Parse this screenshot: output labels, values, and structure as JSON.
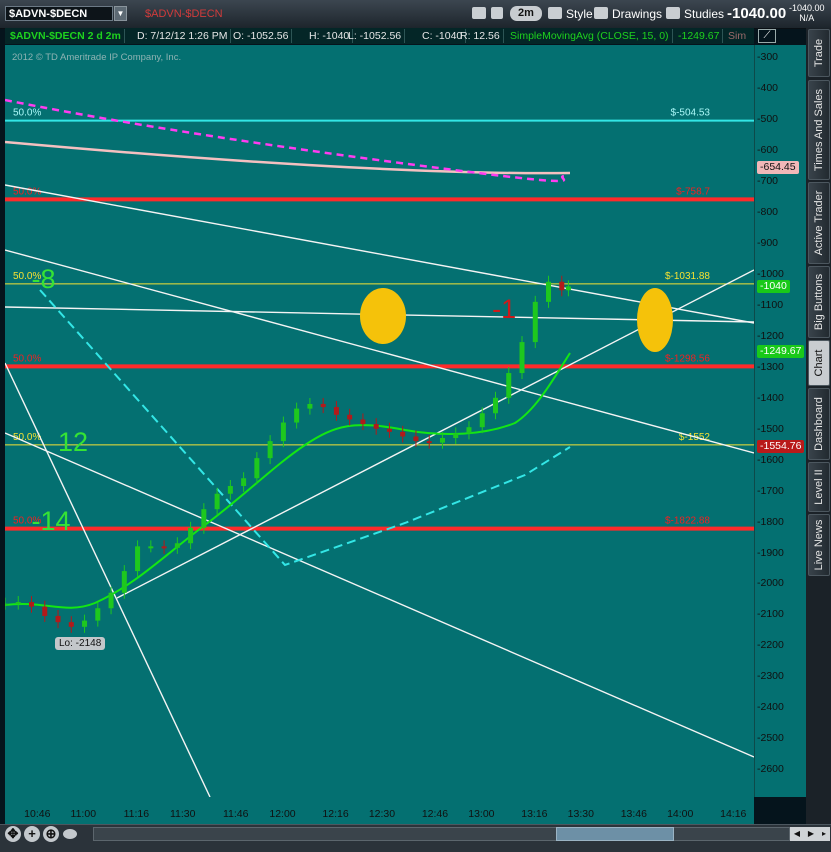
{
  "symbol_box": "$ADVN-$DECN",
  "symbol_desc": "$ADVN-$DECN",
  "toolbar": {
    "aggregation": "2m",
    "style": "Style",
    "drawings": "Drawings",
    "studies": "Studies",
    "last_price": "-1040.00",
    "net_change": "-1040.00",
    "net_change_pct": "N/A"
  },
  "info": {
    "title": "$ADVN-$DECN 2 d 2m",
    "date": "D: 7/12/12 1:26 PM",
    "open": "O: -1052.56",
    "high": "H: -1040",
    "low": "L: -1052.56",
    "close": "C: -1040",
    "range": "R: 12.56",
    "study": "SimpleMovingAvg (CLOSE, 15, 0)",
    "study_value": "-1249.67",
    "truncated": "Sim"
  },
  "copyright": "2012 © TD Ameritrade IP Company, Inc.",
  "y_ticks": [
    "-300",
    "-400",
    "-500",
    "-600",
    "-700",
    "-800",
    "-900",
    "-1000",
    "-1100",
    "-1200",
    "-1300",
    "-1400",
    "-1500",
    "-1600",
    "-1700",
    "-1800",
    "-1900",
    "-2000",
    "-2100",
    "-2200",
    "-2300",
    "-2400",
    "-2500",
    "-2600"
  ],
  "x_ticks": [
    "10:46",
    "11:00",
    "11:16",
    "11:30",
    "11:46",
    "12:00",
    "12:16",
    "12:30",
    "12:46",
    "13:00",
    "13:16",
    "13:30",
    "13:46",
    "14:00",
    "14:16"
  ],
  "y_tags": [
    {
      "text": "-654.45",
      "bg": "#f2b8b8",
      "fg": "#111111",
      "value": -654.45
    },
    {
      "text": "-1040",
      "bg": "#19c919",
      "fg": "#ffffff",
      "value": -1040
    },
    {
      "text": "-1249.67",
      "bg": "#19c919",
      "fg": "#ffffff",
      "value": -1249.67
    },
    {
      "text": "-1554.76",
      "bg": "#b91a1a",
      "fg": "#ffffff",
      "value": -1554.76
    }
  ],
  "levels": [
    {
      "price": -504.53,
      "color": "#33e6e6",
      "left_label": "50.0%",
      "right_label": "$-504.53",
      "label_color": "#a9f7f7",
      "width": 2
    },
    {
      "price": -758.7,
      "color": "#ff2a2a",
      "left_label": "50.0%",
      "right_label": "$-758.7",
      "label_color": "#e22",
      "width": 4
    },
    {
      "price": -1031.88,
      "color": "#f5e233",
      "left_label": "50.0%",
      "right_label": "$-1031.88",
      "label_color": "#f5e233",
      "width": 1
    },
    {
      "price": -1298.56,
      "color": "#ff2a2a",
      "left_label": "50.0%",
      "right_label": "$-1298.56",
      "label_color": "#e22",
      "width": 4
    },
    {
      "price": -1552,
      "color": "#f5e233",
      "left_label": "50.0%",
      "right_label": "$-1552",
      "label_color": "#f5e233",
      "width": 1
    },
    {
      "price": -1822.88,
      "color": "#ff2a2a",
      "left_label": "50.0%",
      "right_label": "$-1822.88",
      "label_color": "#e22",
      "width": 4
    }
  ],
  "annotations": [
    {
      "text": "-8",
      "color": "#35e335",
      "price": -1018,
      "time": "10:44"
    },
    {
      "text": "-1",
      "color": "#cc1a1a",
      "price": -1115,
      "time": "13:03"
    },
    {
      "text": "12",
      "color": "#35e335",
      "price": -1545,
      "time": "10:52"
    },
    {
      "text": "-14",
      "color": "#35e335",
      "price": -1800,
      "time": "10:44"
    }
  ],
  "low_label": "Lo: -2148",
  "sidebar_tabs": [
    "Trade",
    "Times And Sales",
    "Active Trader",
    "Big Buttons",
    "Chart",
    "Dashboard",
    "Level II",
    "Live News"
  ],
  "active_tab": "Chart",
  "colors": {
    "chart_bg": "#047071",
    "up": "#1ec81e",
    "down": "#b21a1a",
    "sma": "#14e614",
    "cyan": "#33e6e6",
    "magenta": "#ff3cf0"
  },
  "chart_data": {
    "type": "candlestick",
    "y_range": [
      -2690,
      -260
    ],
    "x_range": [
      "10:36",
      "14:22"
    ],
    "bars_summary": {
      "open_time": "10:36",
      "close_time": "13:26",
      "low": -2148,
      "last": -1040
    },
    "closes": [
      {
        "time": "10:36",
        "value": -2065
      },
      {
        "time": "10:40",
        "value": -2060
      },
      {
        "time": "10:44",
        "value": -2075
      },
      {
        "time": "10:48",
        "value": -2105
      },
      {
        "time": "10:52",
        "value": -2125
      },
      {
        "time": "10:56",
        "value": -2140
      },
      {
        "time": "11:00",
        "value": -2120
      },
      {
        "time": "11:04",
        "value": -2080
      },
      {
        "time": "11:08",
        "value": -2030
      },
      {
        "time": "11:12",
        "value": -1960
      },
      {
        "time": "11:16",
        "value": -1880
      },
      {
        "time": "11:20",
        "value": -1880
      },
      {
        "time": "11:24",
        "value": -1885
      },
      {
        "time": "11:28",
        "value": -1870
      },
      {
        "time": "11:32",
        "value": -1820
      },
      {
        "time": "11:36",
        "value": -1760
      },
      {
        "time": "11:40",
        "value": -1710
      },
      {
        "time": "11:44",
        "value": -1685
      },
      {
        "time": "11:48",
        "value": -1660
      },
      {
        "time": "11:52",
        "value": -1595
      },
      {
        "time": "11:56",
        "value": -1540
      },
      {
        "time": "12:00",
        "value": -1480
      },
      {
        "time": "12:04",
        "value": -1435
      },
      {
        "time": "12:08",
        "value": -1420
      },
      {
        "time": "12:12",
        "value": -1430
      },
      {
        "time": "12:16",
        "value": -1455
      },
      {
        "time": "12:20",
        "value": -1470
      },
      {
        "time": "12:24",
        "value": -1485
      },
      {
        "time": "12:28",
        "value": -1500
      },
      {
        "time": "12:32",
        "value": -1510
      },
      {
        "time": "12:36",
        "value": -1525
      },
      {
        "time": "12:40",
        "value": -1540
      },
      {
        "time": "12:44",
        "value": -1545
      },
      {
        "time": "12:48",
        "value": -1530
      },
      {
        "time": "12:52",
        "value": -1515
      },
      {
        "time": "12:56",
        "value": -1495
      },
      {
        "time": "13:00",
        "value": -1450
      },
      {
        "time": "13:04",
        "value": -1400
      },
      {
        "time": "13:08",
        "value": -1320
      },
      {
        "time": "13:12",
        "value": -1220
      },
      {
        "time": "13:16",
        "value": -1090
      },
      {
        "time": "13:20",
        "value": -1025
      },
      {
        "time": "13:24",
        "value": -1052.56
      },
      {
        "time": "13:26",
        "value": -1040
      }
    ]
  }
}
